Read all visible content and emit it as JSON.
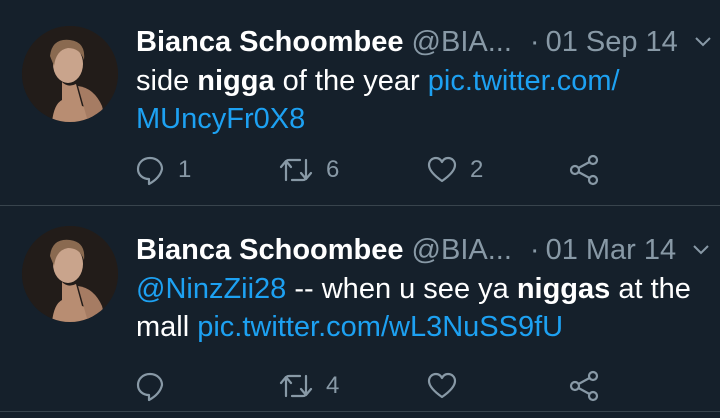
{
  "tweets": [
    {
      "author": "Bianca Schoombee",
      "handle": "@BIA...",
      "separator": "·",
      "date": "01 Sep 14",
      "text_parts": [
        "side ",
        "nigga",
        " of the year ",
        "pic.twitter.com/",
        "MUncyFr0X8"
      ],
      "reply_count": "1",
      "retweet_count": "6",
      "like_count": "2"
    },
    {
      "author": "Bianca Schoombee",
      "handle": "@BIA...",
      "separator": "·",
      "date": "01 Mar 14",
      "text_parts": [
        "@NinzZii28",
        " -- when u see ya ",
        "niggas",
        " at the",
        "mall ",
        "pic.twitter.com/wL3NuSS9fU"
      ],
      "reply_count": "",
      "retweet_count": "4",
      "like_count": ""
    }
  ],
  "icons": {
    "reply": "reply-icon",
    "retweet": "retweet-icon",
    "like": "heart-icon",
    "share": "share-icon",
    "more": "chevron-down-icon"
  },
  "colors": {
    "background": "#15202b",
    "text": "#ffffff",
    "secondary": "#8899a6",
    "link": "#1da1f2",
    "divider": "#38444d"
  }
}
